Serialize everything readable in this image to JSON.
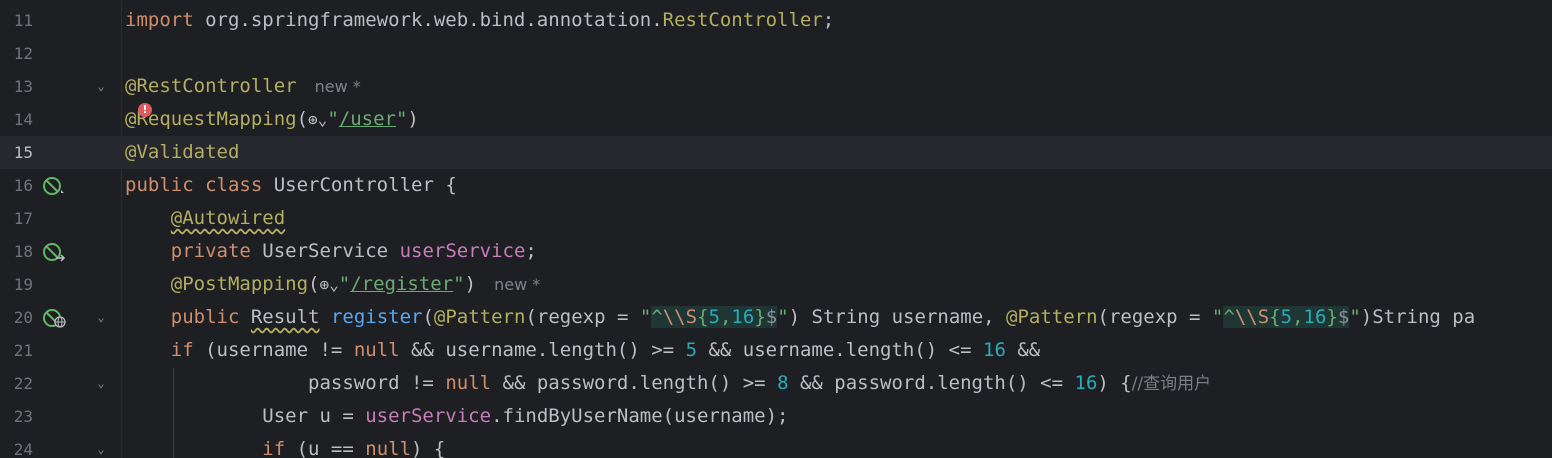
{
  "editor": {
    "current_line": "15",
    "lines": [
      {
        "no": "11",
        "t": {
          "kw": "import",
          "pkg": " org.springframework.web.bind.annotation.",
          "cls": "RestController",
          "semi": ";"
        }
      },
      {
        "no": "12"
      },
      {
        "no": "13",
        "t": {
          "ann": "@RestController",
          "hint": "new *"
        }
      },
      {
        "no": "14",
        "t": {
          "ann": "@RequestMapping",
          "open": "(",
          "glob": "⊕⌄",
          "q1": "\"",
          "path": "/user",
          "q2": "\"",
          "close": ")"
        }
      },
      {
        "no": "15",
        "t": {
          "ann": "@Validated"
        }
      },
      {
        "no": "16",
        "t": {
          "kw1": "public",
          "kw2": "class",
          "name": " UserController {"
        }
      },
      {
        "no": "17",
        "t": {
          "ann": "@Autowired"
        }
      },
      {
        "no": "18",
        "t": {
          "kw": "private",
          "type": " UserService ",
          "field": "userService",
          "semi": ";"
        }
      },
      {
        "no": "19",
        "t": {
          "ann": "@PostMapping",
          "open": "(",
          "glob": "⊕⌄",
          "q1": "\"",
          "path": "/register",
          "q2": "\"",
          "close": ")",
          "hint": "new *"
        }
      },
      {
        "no": "20",
        "t": {
          "kw": "public",
          "type": "Result",
          "fn": "register",
          "open": "(",
          "ann1": "@Pattern",
          "mid1": "(regexp = ",
          "q": "\"",
          "re_caret": "^",
          "re_esc": "\\\\S",
          "re_lb": "{",
          "re_n1": "5",
          "re_comma": ",",
          "re_n2": "16",
          "re_rb": "}",
          "re_dollar": "$",
          "tail1": ") String username, ",
          "ann2": "@Pattern",
          "mid2": "(regexp = ",
          "tail2": ")String pa"
        }
      },
      {
        "no": "21",
        "t": {
          "kw_if": "if",
          "s1": " (username != ",
          "null1": "null",
          "s2": " && username.length() >= ",
          "n1": "5",
          "s3": " && username.length() <= ",
          "n2": "16",
          "s4": " &&"
        }
      },
      {
        "no": "22",
        "t": {
          "s1": "password != ",
          "null1": "null",
          "s2": " && password.length() >= ",
          "n1": "8",
          "s3": " && password.length() <= ",
          "n2": "16",
          "s4": ") {",
          "comment": "//查询用户"
        }
      },
      {
        "no": "23",
        "t": {
          "s1": "User u = ",
          "field": "userService",
          "s2": ".findByUserName(username);"
        }
      },
      {
        "no": "24",
        "t": {
          "kw_if": "if",
          "s1": " (u == ",
          "null1": "null",
          "s2": ") {"
        }
      }
    ]
  },
  "gutter_icons": {
    "16": "spring-bean-icon",
    "18": "spring-bean-navigate-icon",
    "20": "spring-web-endpoint-icon"
  },
  "error_bulb": {
    "icon": "error-lightbulb-icon",
    "glyph": "!"
  }
}
